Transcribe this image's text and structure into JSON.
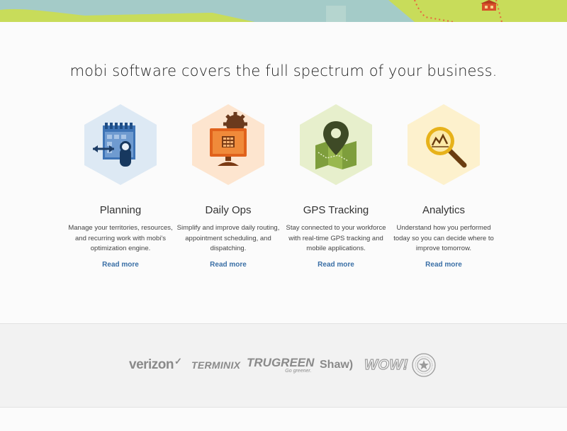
{
  "headline": "mobi software covers the full spectrum of your business.",
  "colors": {
    "link": "#3a6fa6",
    "hero_map_water": "#a4cbc8",
    "hero_map_land": "#c8dc5a"
  },
  "features": [
    {
      "title": "Planning",
      "description": "Manage your territories, resources, and recurring work with mobi's optimization engine.",
      "link": "Read more",
      "icon": "calendar-planning-icon",
      "hex_color": "#dde9f4"
    },
    {
      "title": "Daily Ops",
      "description": "Simplify and improve daily routing, appointment scheduling, and dispatching.",
      "link": "Read more",
      "icon": "monitor-gear-icon",
      "hex_color": "#fde5cf"
    },
    {
      "title": "GPS Tracking",
      "description": "Stay connected to your workforce with real-time GPS tracking and mobile applications.",
      "link": "Read more",
      "icon": "map-pin-icon",
      "hex_color": "#e7efcc"
    },
    {
      "title": "Analytics",
      "description": "Understand how you performed today so you can decide where to improve tomorrow.",
      "link": "Read more",
      "icon": "magnifier-chart-icon",
      "hex_color": "#fdf1cd"
    }
  ],
  "clients": {
    "verizon": "verizon",
    "terminix": "TERMINIX",
    "trugreen": "TRUGREEN",
    "trugreen_tagline": "Go greener.",
    "shaw": "Shaw)",
    "wow": "WOW!"
  }
}
